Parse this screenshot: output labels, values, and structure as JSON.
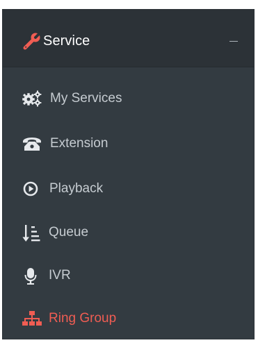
{
  "sidebar": {
    "section": {
      "icon": "wrench-icon",
      "label": "Service",
      "toggle_icon": "minus-icon"
    },
    "items": [
      {
        "label": "My Services",
        "icon": "gears-icon",
        "active": false
      },
      {
        "label": "Extension",
        "icon": "phone-icon",
        "active": false
      },
      {
        "label": "Playback",
        "icon": "play-circle-icon",
        "active": false
      },
      {
        "label": "Queue",
        "icon": "sort-list-icon",
        "active": false
      },
      {
        "label": "IVR",
        "icon": "microphone-icon",
        "active": false
      },
      {
        "label": "Ring Group",
        "icon": "sitemap-icon",
        "active": true
      }
    ]
  },
  "colors": {
    "panel_bg": "#333b41",
    "header_bg": "#2c3237",
    "text": "#c6ccd1",
    "accent": "#f05d53",
    "icon": "#e6e9ec"
  }
}
